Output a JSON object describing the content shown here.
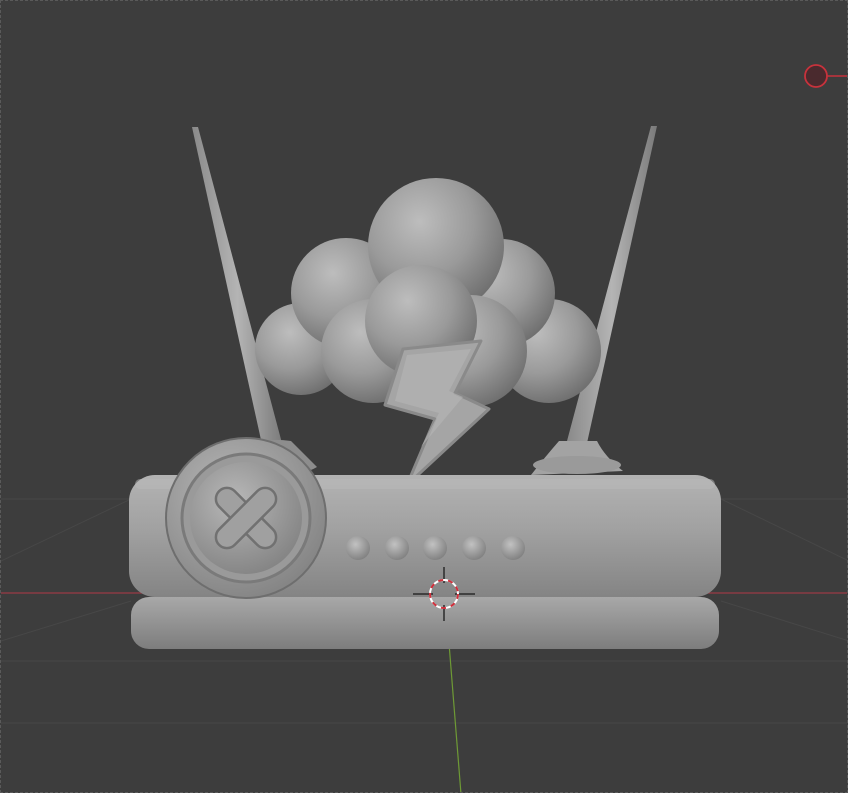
{
  "viewport": {
    "name": "3D Viewport",
    "background": "#3d3d3d",
    "grid_color": "#474747",
    "x_axis_color": "#9a3b46",
    "y_axis_color": "#6e9a35"
  },
  "scene": {
    "model": "router-with-storm-cloud-and-error-badge",
    "material_color": "#9c9c9c",
    "status_dots": 5,
    "icons": [
      "cloud-icon",
      "lightning-bolt-icon",
      "error-x-icon"
    ]
  },
  "gizmos": {
    "cursor_3d": "3d-cursor-icon",
    "camera_marker": "camera-handle-icon",
    "camera_marker_color": "#c8323c"
  }
}
